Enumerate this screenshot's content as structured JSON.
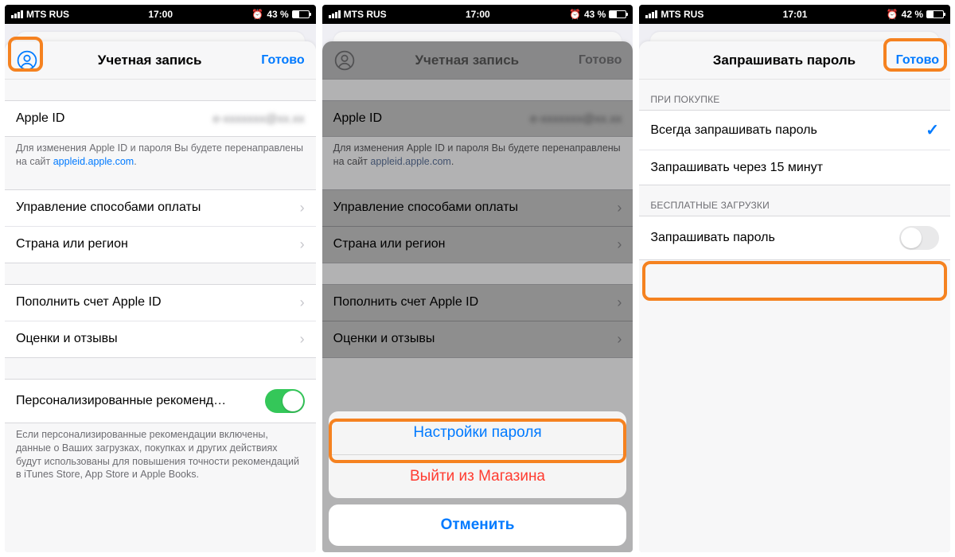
{
  "status": {
    "carrier": "MTS RUS",
    "time1": "17:00",
    "time2": "17:00",
    "time3": "17:01",
    "batt1": "43 %",
    "batt2": "43 %",
    "batt3": "42 %"
  },
  "screen1": {
    "nav_title": "Учетная запись",
    "done": "Готово",
    "apple_id_label": "Apple ID",
    "footnote": "Для изменения Apple ID и пароля Вы будете перенаправлены на сайт ",
    "footnote_link": "appleid.apple.com",
    "footnote_period": ".",
    "rows1": {
      "payment": "Управление способами оплаты",
      "country": "Страна или регион"
    },
    "rows2": {
      "topup": "Пополнить счет Apple ID",
      "ratings": "Оценки и отзывы"
    },
    "personal_row": "Персонализированные рекоменд…",
    "personal_footnote": "Если персонализированные рекомендации включены, данные о Ваших загрузках, покупках и других действиях будут использованы для повышения точности рекомендаций в iTunes Store, App Store и Apple Books."
  },
  "screen2": {
    "nav_title": "Учетная запись",
    "done": "Готово",
    "apple_id_label": "Apple ID",
    "footnote": "Для изменения Apple ID и пароля Вы будете перенаправлены на сайт ",
    "footnote_link": "appleid.apple.com",
    "footnote_period": ".",
    "rows1": {
      "payment": "Управление способами оплаты",
      "country": "Страна или регион"
    },
    "rows2": {
      "topup": "Пополнить счет Apple ID",
      "ratings": "Оценки и отзывы"
    },
    "action": {
      "pw_settings": "Настройки пароля",
      "signout": "Выйти из Магазина",
      "cancel": "Отменить"
    }
  },
  "screen3": {
    "nav_title": "Запрашивать пароль",
    "done": "Готово",
    "section_purchase": "ПРИ ПОКУПКЕ",
    "always": "Всегда запрашивать пароль",
    "after15": "Запрашивать через 15 минут",
    "section_free": "БЕСПЛАТНЫЕ ЗАГРУЗКИ",
    "require_pw": "Запрашивать пароль"
  },
  "icons": {
    "alarm": "⏰"
  }
}
